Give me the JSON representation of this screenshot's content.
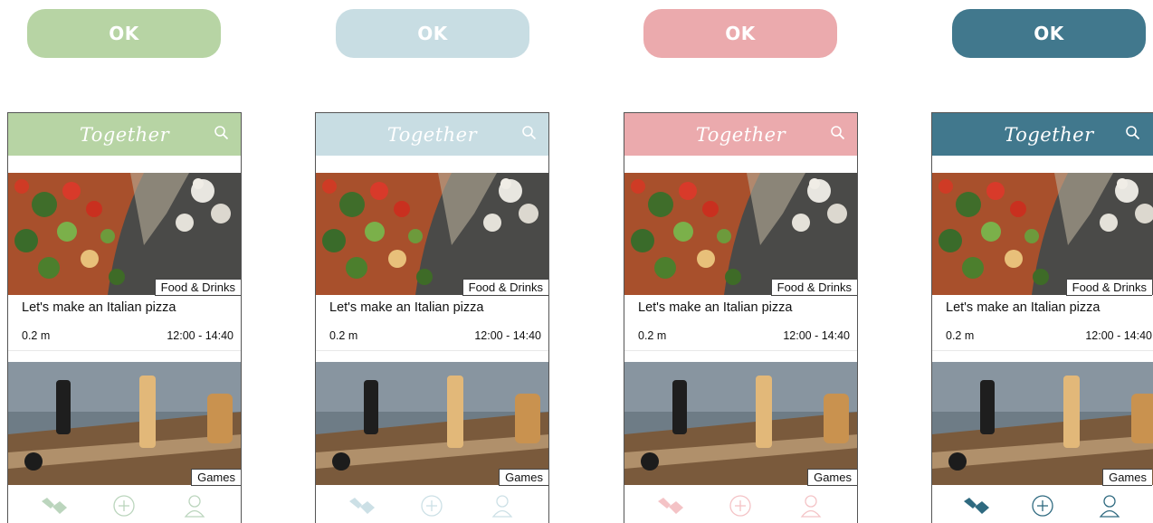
{
  "variants": [
    {
      "ok_label": "OK",
      "accent": "#b7d4a4",
      "app_title": "Together",
      "card1": {
        "category": "Food & Drinks",
        "title": "Let's make an Italian pizza",
        "distance": "0.2 m",
        "time": "12:00 - 14:40"
      },
      "card2": {
        "category": "Games"
      },
      "tabs": [
        "handshake-icon",
        "add-icon",
        "profile-icon"
      ]
    },
    {
      "ok_label": "OK",
      "accent": "#c8dde3",
      "app_title": "Together",
      "card1": {
        "category": "Food & Drinks",
        "title": "Let's make an Italian pizza",
        "distance": "0.2 m",
        "time": "12:00 - 14:40"
      },
      "card2": {
        "category": "Games"
      },
      "tabs": [
        "handshake-icon",
        "add-icon",
        "profile-icon"
      ]
    },
    {
      "ok_label": "OK",
      "accent": "#ebaaad",
      "app_title": "Together",
      "card1": {
        "category": "Food & Drinks",
        "title": "Let's make an Italian pizza",
        "distance": "0.2 m",
        "time": "12:00 - 14:40"
      },
      "card2": {
        "category": "Games"
      },
      "tabs": [
        "handshake-icon",
        "add-icon",
        "profile-icon"
      ]
    },
    {
      "ok_label": "OK",
      "accent": "#41788d",
      "app_title": "Together",
      "card1": {
        "category": "Food & Drinks",
        "title": "Let's make an Italian pizza",
        "distance": "0.2 m",
        "time": "12:00 - 14:40"
      },
      "card2": {
        "category": "Games"
      },
      "tabs": [
        "handshake-icon",
        "add-icon",
        "profile-icon"
      ]
    }
  ]
}
